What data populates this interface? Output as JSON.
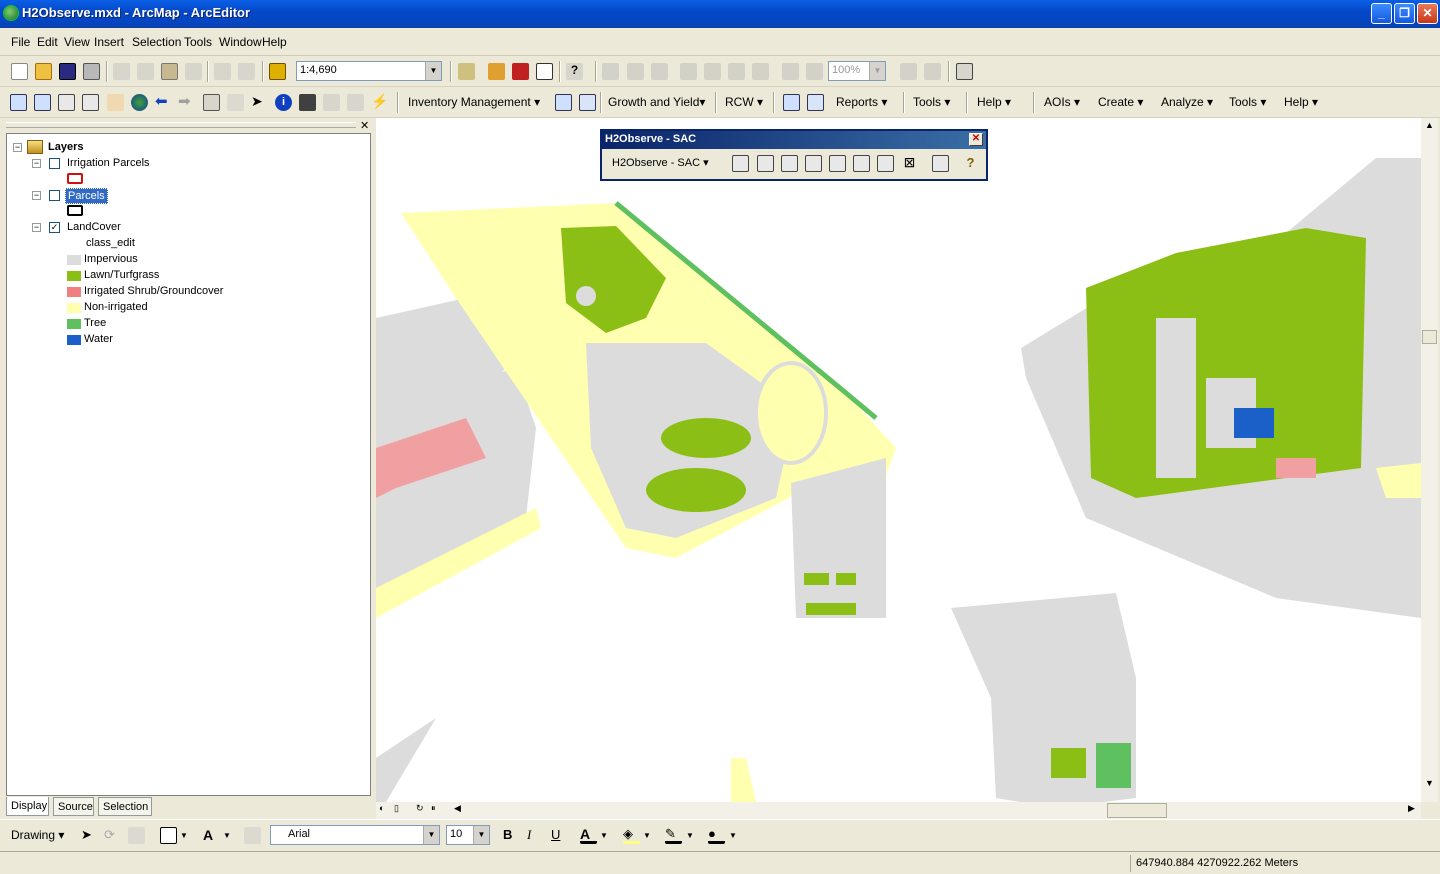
{
  "window": {
    "title": "H2Observe.mxd - ArcMap - ArcEditor"
  },
  "menu": [
    "File",
    "Edit",
    "View",
    "Insert",
    "Selection",
    "Tools",
    "Window",
    "Help"
  ],
  "standard_toolbar": {
    "scale": "1:4,690",
    "zoom": "100%"
  },
  "tools_toolbar": {
    "menus": [
      "Inventory Management",
      "Growth and Yield",
      "RCW",
      "Reports",
      "Tools",
      "Help",
      "AOIs",
      "Create",
      "Analyze",
      "Tools",
      "Help"
    ]
  },
  "toc": {
    "root": "Layers",
    "layers": [
      {
        "name": "Irrigation Parcels",
        "checked": false
      },
      {
        "name": "Parcels",
        "checked": false,
        "selected": true
      },
      {
        "name": "LandCover",
        "checked": true,
        "field": "class_edit"
      }
    ],
    "legend": [
      {
        "label": "Impervious",
        "color": "#dcdcdc"
      },
      {
        "label": "Lawn/Turfgrass",
        "color": "#8cbf16"
      },
      {
        "label": "Irrigated Shrub/Groundcover",
        "color": "#f08080"
      },
      {
        "label": "Non-irrigated",
        "color": "#ffffb0"
      },
      {
        "label": "Tree",
        "color": "#5ec05e"
      },
      {
        "label": "Water",
        "color": "#1b60c8"
      }
    ],
    "tabs": [
      "Display",
      "Source",
      "Selection"
    ]
  },
  "sac_toolbar": {
    "title": "H2Observe - SAC",
    "dropdown": "H2Observe - SAC"
  },
  "drawing_toolbar": {
    "drawing_label": "Drawing",
    "font": "Arial",
    "size": "10",
    "bold": "B",
    "italic": "I",
    "underline": "U",
    "font_color_glyph": "A"
  },
  "status": {
    "coords": "647940.884  4270922.262 Meters"
  }
}
